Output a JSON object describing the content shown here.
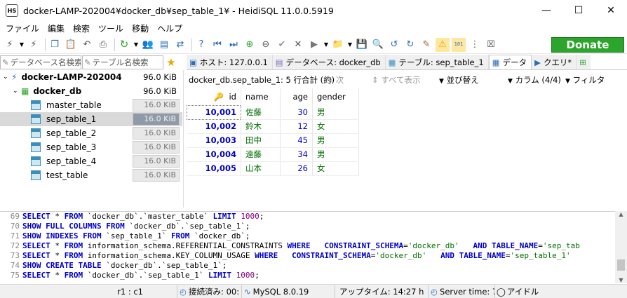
{
  "window": {
    "title": "docker-LAMP-202004¥docker_db¥sep_table_1¥ - HeidiSQL 11.0.0.5919",
    "app_icon": "HS"
  },
  "window_controls": {
    "minimize": "—",
    "maximize": "☐",
    "close": "✕"
  },
  "menu": [
    "ファイル",
    "編集",
    "検索",
    "ツール",
    "移動",
    "ヘルプ"
  ],
  "toolbar": {
    "donate_label": "Donate"
  },
  "left_filters": {
    "database_filter": "データベース名検索",
    "table_filter": "テーブル名検索"
  },
  "tree": {
    "server": {
      "name": "docker-LAMP-202004",
      "size": "96.0 KiB"
    },
    "database": {
      "name": "docker_db",
      "size": "96.0 KiB"
    },
    "tables": [
      {
        "name": "master_table",
        "size": "16.0 KiB"
      },
      {
        "name": "sep_table_1",
        "size": "16.0 KiB",
        "selected": true
      },
      {
        "name": "sep_table_2",
        "size": "16.0 KiB"
      },
      {
        "name": "sep_table_3",
        "size": "16.0 KiB"
      },
      {
        "name": "sep_table_4",
        "size": "16.0 KiB"
      },
      {
        "name": "test_table",
        "size": "16.0 KiB"
      }
    ]
  },
  "tabs": [
    {
      "label": "ホスト: 127.0.0.1"
    },
    {
      "label": "データベース: docker_db"
    },
    {
      "label": "テーブル: sep_table_1"
    },
    {
      "label": "データ",
      "active": true
    },
    {
      "label": "クエリ*"
    }
  ],
  "data_toolbar": {
    "info": "docker_db.sep_table_1: 5 行合計 (約)",
    "next": "次",
    "show_all": "すべて表示",
    "sort": "並び替え",
    "columns": "カラム (4/4)",
    "filter": "フィルタ"
  },
  "grid": {
    "columns": [
      "id",
      "name",
      "age",
      "gender"
    ],
    "rows": [
      {
        "id": "10,001",
        "name": "佐藤",
        "age": "30",
        "gender": "男"
      },
      {
        "id": "10,002",
        "name": "鈴木",
        "age": "12",
        "gender": "女"
      },
      {
        "id": "10,003",
        "name": "田中",
        "age": "45",
        "gender": "男"
      },
      {
        "id": "10,004",
        "name": "遠藤",
        "age": "34",
        "gender": "男"
      },
      {
        "id": "10,005",
        "name": "山本",
        "age": "26",
        "gender": "女"
      }
    ]
  },
  "sql_log": [
    {
      "n": "69",
      "parts": [
        [
          "kw",
          "SELECT"
        ],
        [
          "t",
          " * "
        ],
        [
          "kw",
          "FROM"
        ],
        [
          "t",
          " `docker_db`.`master_table` "
        ],
        [
          "kw",
          "LIMIT"
        ],
        [
          "t",
          " "
        ],
        [
          "num",
          "1000"
        ],
        [
          "t",
          ";"
        ]
      ]
    },
    {
      "n": "70",
      "parts": [
        [
          "kw",
          "SHOW FULL COLUMNS FROM"
        ],
        [
          "t",
          " `docker_db`.`sep_table_1`;"
        ]
      ]
    },
    {
      "n": "71",
      "parts": [
        [
          "kw",
          "SHOW INDEXES FROM"
        ],
        [
          "t",
          " `sep_table_1` "
        ],
        [
          "kw",
          "FROM"
        ],
        [
          "t",
          " `docker_db`;"
        ]
      ]
    },
    {
      "n": "72",
      "parts": [
        [
          "kw",
          "SELECT"
        ],
        [
          "t",
          " * "
        ],
        [
          "kw",
          "FROM"
        ],
        [
          "t",
          " information_schema.REFERENTIAL_CONSTRAINTS "
        ],
        [
          "kw",
          "WHERE"
        ],
        [
          "t",
          "   "
        ],
        [
          "kw",
          "CONSTRAINT_SCHEMA"
        ],
        [
          "t",
          "="
        ],
        [
          "str",
          "'docker_db'"
        ],
        [
          "t",
          "   "
        ],
        [
          "kw",
          "AND"
        ],
        [
          "t",
          " "
        ],
        [
          "kw",
          "TABLE_NAME"
        ],
        [
          "t",
          "="
        ],
        [
          "str",
          "'sep_tab"
        ]
      ]
    },
    {
      "n": "73",
      "parts": [
        [
          "kw",
          "SELECT"
        ],
        [
          "t",
          " * "
        ],
        [
          "kw",
          "FROM"
        ],
        [
          "t",
          " information_schema.KEY_COLUMN_USAGE "
        ],
        [
          "kw",
          "WHERE"
        ],
        [
          "t",
          "   "
        ],
        [
          "kw",
          "CONSTRAINT_SCHEMA"
        ],
        [
          "t",
          "="
        ],
        [
          "str",
          "'docker_db'"
        ],
        [
          "t",
          "   "
        ],
        [
          "kw",
          "AND"
        ],
        [
          "t",
          " "
        ],
        [
          "kw",
          "TABLE_NAME"
        ],
        [
          "t",
          "="
        ],
        [
          "str",
          "'sep_table_1'"
        ]
      ]
    },
    {
      "n": "74",
      "parts": [
        [
          "kw",
          "SHOW CREATE TABLE"
        ],
        [
          "t",
          " `docker_db`.`sep_table_1`;"
        ]
      ]
    },
    {
      "n": "75",
      "parts": [
        [
          "kw",
          "SELECT"
        ],
        [
          "t",
          " * "
        ],
        [
          "kw",
          "FROM"
        ],
        [
          "t",
          " `docker_db`.`sep_table_1` "
        ],
        [
          "kw",
          "LIMIT"
        ],
        [
          "t",
          " "
        ],
        [
          "num",
          "1000"
        ],
        [
          "t",
          ";"
        ]
      ]
    }
  ],
  "statusbar": {
    "cursor": "r1 : c1",
    "connected": "接続済み: 00:",
    "server": "MySQL 8.0.19",
    "uptime": "アップタイム: 14:27 h",
    "server_time": "Server time: 7",
    "idle": "アイドル"
  },
  "colors": {
    "donate_green": "#2ba52b",
    "keyword_blue": "#0000c8",
    "string_green": "#007000",
    "number_purple": "#800080"
  }
}
